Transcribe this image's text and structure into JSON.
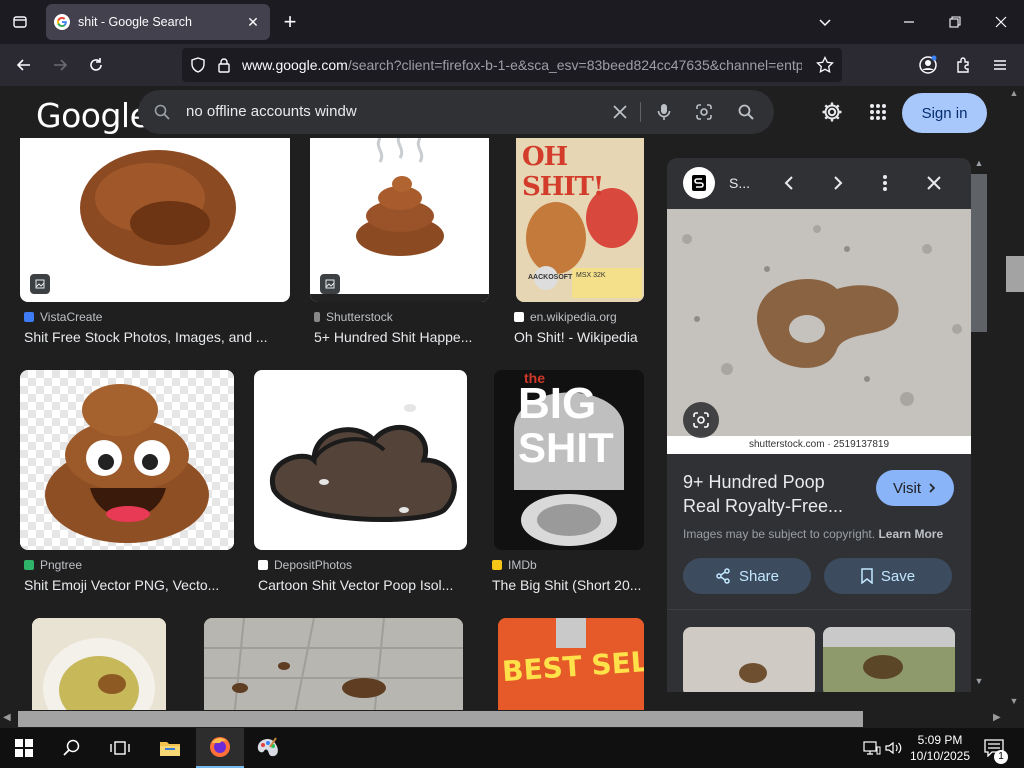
{
  "browser": {
    "tab_title": "shit - Google Search",
    "url_domain": "www.google.com",
    "url_rest": "/search?client=firefox-b-1-e&sca_esv=83beed824cc47635&channel=entpr"
  },
  "google": {
    "logo": "Google",
    "query": "no offline accounts windw",
    "signin_label": "Sign in"
  },
  "results": [
    {
      "source": "VistaCreate",
      "caption": "Shit Free Stock Photos, Images, and ..."
    },
    {
      "source": "Shutterstock",
      "caption": "5+ Hundred Shit Happe..."
    },
    {
      "source": "en.wikipedia.org",
      "caption": "Oh Shit! - Wikipedia"
    },
    {
      "source": "Pngtree",
      "caption": "Shit Emoji Vector PNG, Vecto..."
    },
    {
      "source": "DepositPhotos",
      "caption": "Cartoon Shit Vector Poop Isol..."
    },
    {
      "source": "IMDb",
      "caption": "The Big Shit (Short 20..."
    }
  ],
  "thumb_text": {
    "ohshit": "OH SHIT!",
    "msx": "MSX 32K",
    "aackosoft": "AACKOSOFT",
    "big_the": "the",
    "big_line1": "BIG",
    "big_line2": "SHIT",
    "bestseller": "BEST SELLER"
  },
  "panel": {
    "source_short": "S...",
    "credit": "shutterstock.com · 2519137819",
    "title": "9+ Hundred Poop Real Royalty-Free...",
    "visit_label": "Visit",
    "note": "Images may be subject to copyright.",
    "note_link": "Learn More",
    "share_label": "Share",
    "save_label": "Save"
  },
  "taskbar": {
    "time": "5:09 PM",
    "date": "10/10/2025",
    "notif_count": "1"
  }
}
